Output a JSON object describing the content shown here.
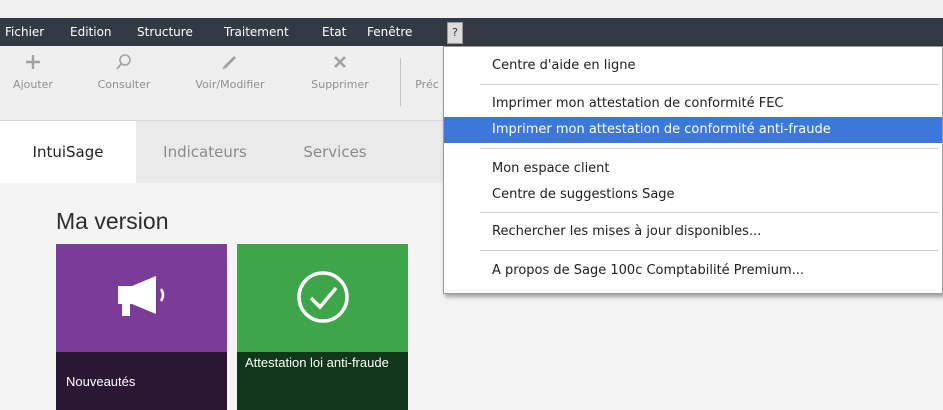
{
  "menubar": {
    "items": [
      "Fichier",
      "Edition",
      "Structure",
      "Traitement",
      "Etat",
      "Fenêtre"
    ],
    "help_label": "?"
  },
  "toolbar": {
    "buttons": [
      {
        "label": "Ajouter",
        "icon": "plus-icon"
      },
      {
        "label": "Consulter",
        "icon": "search-icon"
      },
      {
        "label": "Voir/Modifier",
        "icon": "pencil-icon"
      },
      {
        "label": "Supprimer",
        "icon": "delete-icon"
      },
      {
        "label": "Préc"
      }
    ]
  },
  "tabs": [
    {
      "label": "IntuiSage",
      "active": true
    },
    {
      "label": "Indicateurs",
      "active": false
    },
    {
      "label": "Services",
      "active": false
    }
  ],
  "section": {
    "title": "Ma version"
  },
  "tiles": [
    {
      "label": "Nouveautés",
      "icon": "megaphone-icon",
      "color": "#7b3c97"
    },
    {
      "label": "Attestation loi anti-fraude",
      "icon": "check-circle-icon",
      "color": "#3fa54a"
    }
  ],
  "help_menu": {
    "items": [
      {
        "label": "Centre d'aide en ligne"
      },
      {
        "label": "Imprimer mon attestation de conformité FEC"
      },
      {
        "label": "Imprimer mon attestation de conformité anti-fraude",
        "highlighted": true
      },
      {
        "label": "Mon espace client"
      },
      {
        "label": "Centre de suggestions Sage"
      },
      {
        "label": "Rechercher les mises à jour disponibles..."
      },
      {
        "label": "A propos de Sage 100c Comptabilité Premium..."
      }
    ]
  },
  "colors": {
    "menubar": "#343a44",
    "highlight": "#3c78d8"
  }
}
